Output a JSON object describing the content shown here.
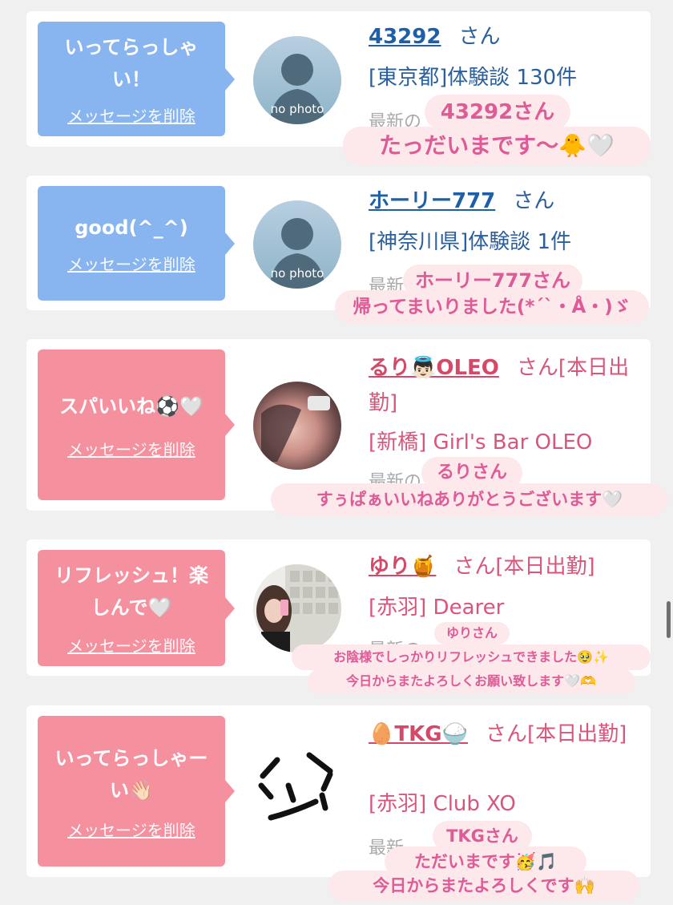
{
  "cards": [
    {
      "message": "いってらっしゃい！",
      "delete_label": "メッセージを削除",
      "avatar_text": "no photo",
      "name": "43292",
      "san": "さん",
      "shop": "[東京都]体験談 130件",
      "recent": "最新の",
      "overlay_lines": [
        "43292さん",
        "たっだいまです〜🐥🤍"
      ]
    },
    {
      "message": "good(^_^)",
      "delete_label": "メッセージを削除",
      "avatar_text": "no photo",
      "name": "ホーリー777",
      "san": "さん",
      "shop": "[神奈川県]体験談 1件",
      "recent": "最新",
      "overlay_lines": [
        "ホーリー777さん",
        "帰ってまいりました(*´`・Å・)ゞ"
      ]
    },
    {
      "message": "スパいいね⚽🤍",
      "delete_label": "メッセージを削除",
      "name": "るり👼🏻OLEO",
      "san": "さん[本日出勤]",
      "shop": "[新橋] Girl's Bar OLEO",
      "recent": "最新の",
      "overlay_lines": [
        "るりさん",
        "すぅぱぁいいねありがとうございます🤍"
      ]
    },
    {
      "message": "リフレッシュ！楽しんで🤍",
      "delete_label": "メッセージを削除",
      "name": "ゆり🍯",
      "san": "さん[本日出勤]",
      "shop": "[赤羽] Dearer",
      "recent": "最新の",
      "overlay_lines": [
        "ゆりさん",
        "お陰様でしっかりリフレッシュできました🥹✨",
        "今日からまたよろしくお願い致します🤍🫶"
      ]
    },
    {
      "message": "いってらっしゃーい👋🏻",
      "delete_label": "メッセージを削除",
      "name": "🥚TKG🍚",
      "san": "さん[本日出勤]",
      "shop": "[赤羽] Club XO",
      "recent": "最新",
      "overlay_lines": [
        "TKGさん",
        "ただいまです🥳🎵",
        "今日からまたよろしくです🙌"
      ]
    }
  ],
  "colors": {
    "blue_bubble": "#88b4ef",
    "pink_bubble": "#f5909f",
    "overlay_bg": "#fde8ec",
    "overlay_text": "#de5b96"
  }
}
